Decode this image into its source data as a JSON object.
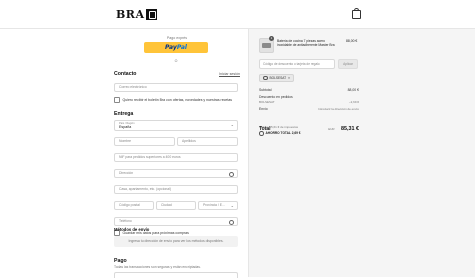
{
  "header": {
    "logo_text": "BRA",
    "cart_icon": "shopping-bag-icon"
  },
  "express": {
    "label": "Pago exprés",
    "paypal_part1": "Pay",
    "paypal_part2": "Pal",
    "or": "O"
  },
  "contact": {
    "title": "Contacto",
    "login_link": "Iniciar sesión",
    "email_placeholder": "Correo electrónico",
    "newsletter_label": "Quiero recibir el boletín Bra con ofertas, novedades y nuestras recetas"
  },
  "delivery": {
    "title": "Entrega",
    "country_label": "País / Región",
    "country_value": "España",
    "first_name": "Nombre",
    "last_name": "Apellidos",
    "nif": "NIF para pedidos superiores a 400 euros",
    "address": "Dirección",
    "apartment": "Casa, apartamento, etc. (opcional)",
    "postal_code": "Código postal",
    "city": "Ciudad",
    "province": "Provincia / E...",
    "phone": "Teléfono",
    "save_info": "Guardar mis datos para próximas compras"
  },
  "shipping": {
    "title": "Métodos de envío",
    "message": "Ingresa tu dirección de envío para ver los métodos disponibles."
  },
  "payment": {
    "title": "Pago",
    "subtitle": "Todas las transacciones son seguras y están encriptadas."
  },
  "summary": {
    "product_name": "Batería de cocina 7 piezas acero inoxidable de antiadherente Master Bra",
    "product_qty": "1",
    "product_price": "88,00 €",
    "discount_placeholder": "Código de descuento o tarjeta de regalo",
    "apply_label": "Aplicar",
    "discount_code": "BOLSESAT",
    "subtotal_label": "Subtotal",
    "subtotal_value": "88,00 €",
    "discount_label": "Descuento en pedidos",
    "discount_code_small": "BOLSESAT",
    "discount_value": "−2,69 €",
    "shipping_label": "Envío",
    "shipping_value": "Introducir la dirección de envío",
    "total_label": "Total",
    "total_currency": "EUR",
    "total_value": "85,31 €",
    "tax_note": "Incluye 15,61 € de impuestos",
    "savings": "AHORRO TOTAL  2,69 €"
  }
}
